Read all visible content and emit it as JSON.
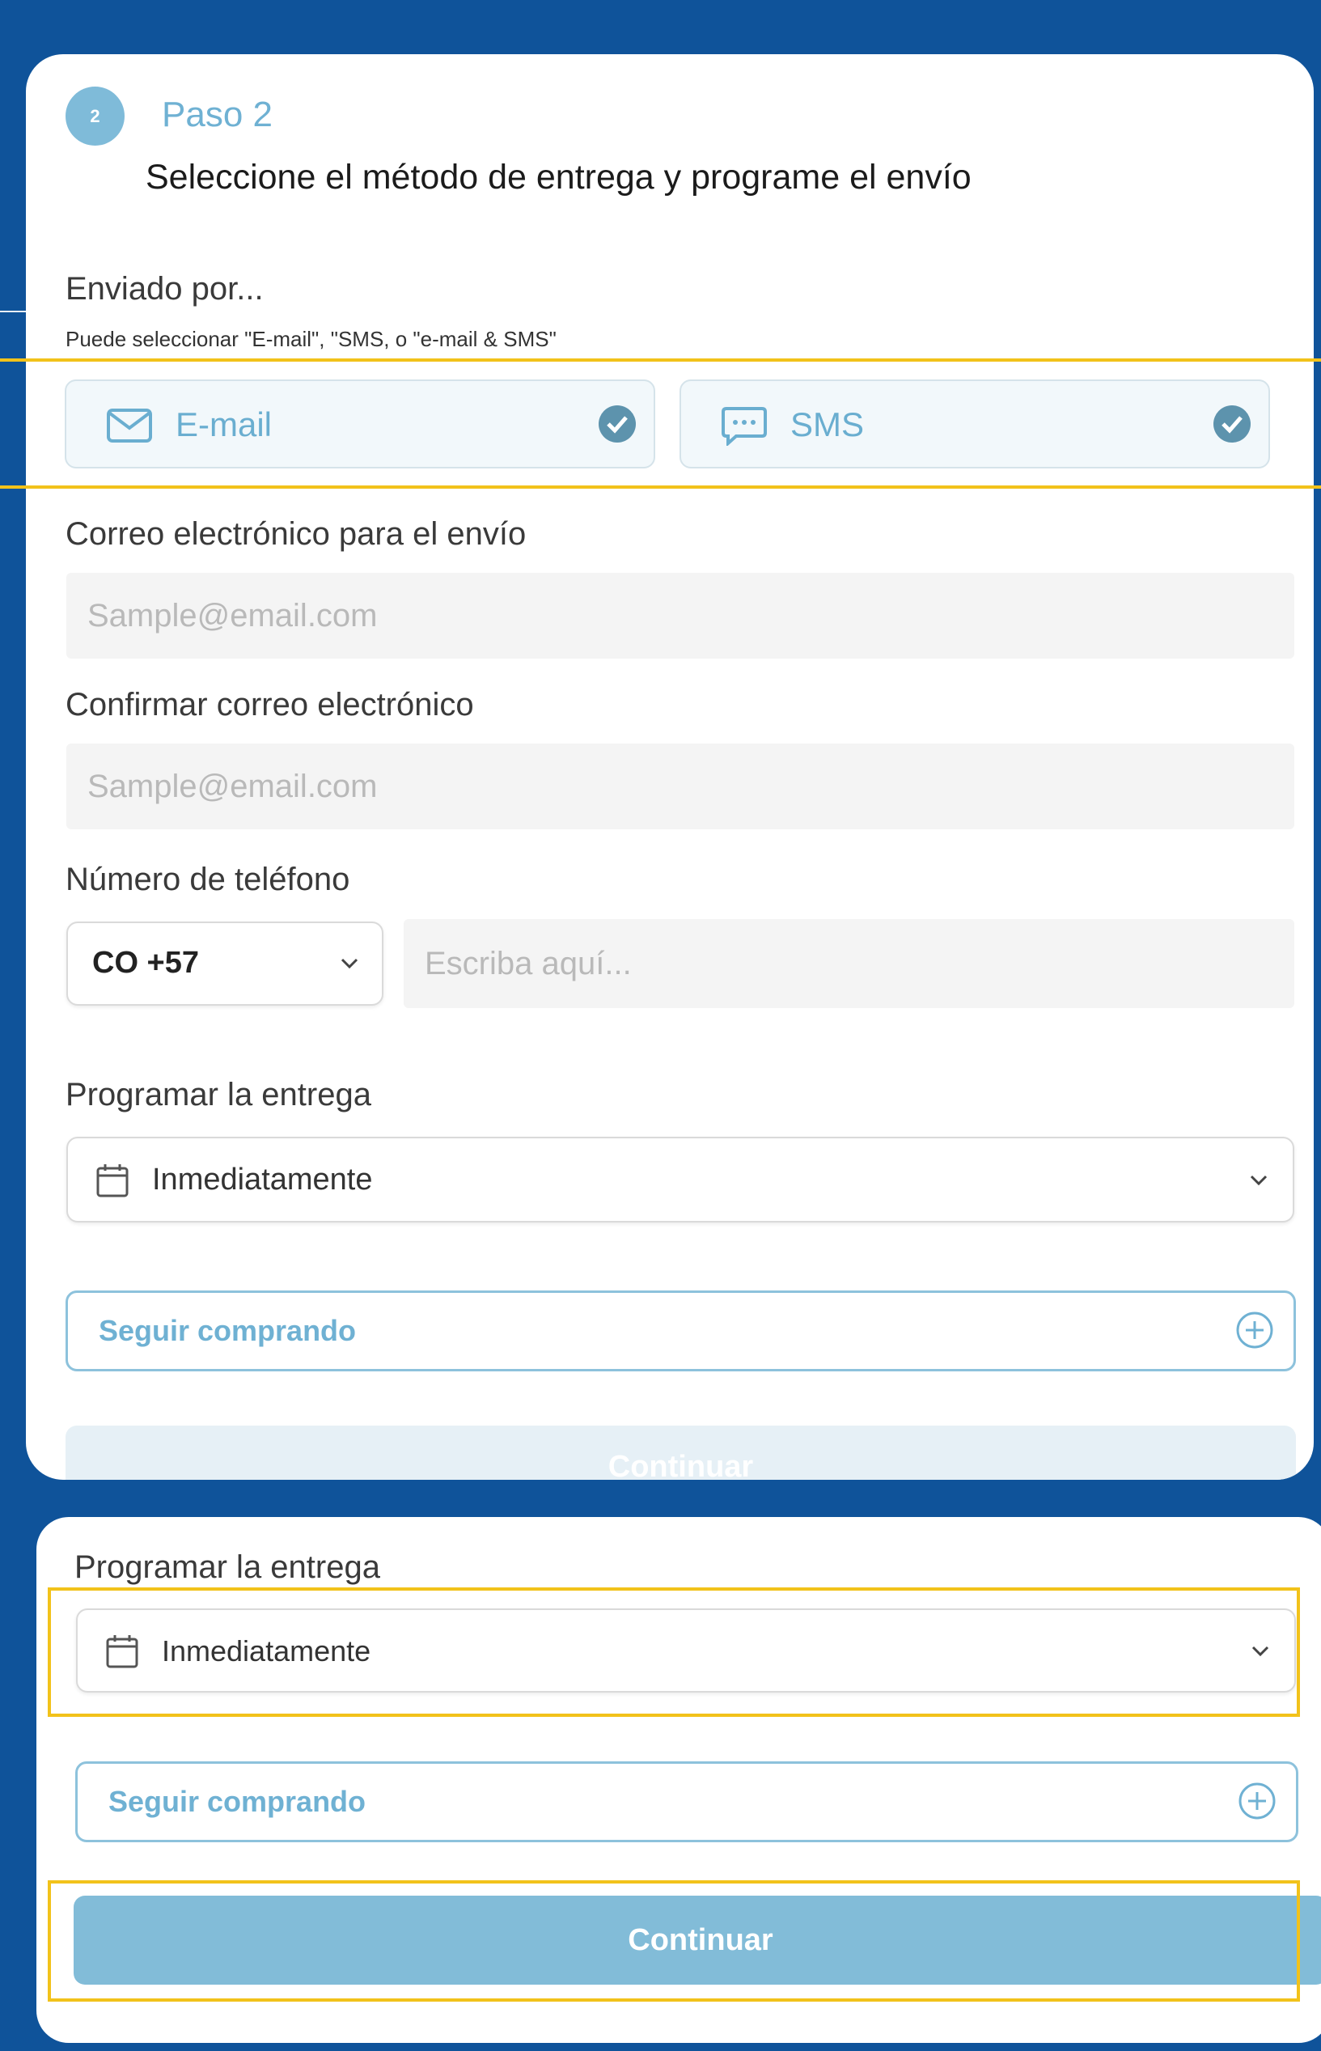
{
  "step": {
    "number": "2",
    "label": "Paso 2",
    "title": "Seleccione el método de entrega y programe el envío"
  },
  "sent_by": {
    "label": "Enviado por...",
    "hint": "Puede seleccionar \"E-mail\", \"SMS, o \"e-mail & SMS\""
  },
  "methods": {
    "email": "E-mail",
    "sms": "SMS"
  },
  "email": {
    "label": "Correo electrónico para el envío",
    "placeholder": "Sample@email.com"
  },
  "confirm_email": {
    "label": "Confirmar correo electrónico",
    "placeholder": "Sample@email.com"
  },
  "phone": {
    "label": "Número de teléfono",
    "country_code": "CO +57",
    "placeholder": "Escriba aquí..."
  },
  "schedule": {
    "label": "Programar la entrega",
    "value": "Inmediatamente"
  },
  "buttons": {
    "keep_shopping": "Seguir comprando",
    "continue": "Continuar"
  },
  "colors": {
    "background": "#0f539a",
    "accent": "#7fbbd9",
    "highlight": "#f2c21a"
  }
}
